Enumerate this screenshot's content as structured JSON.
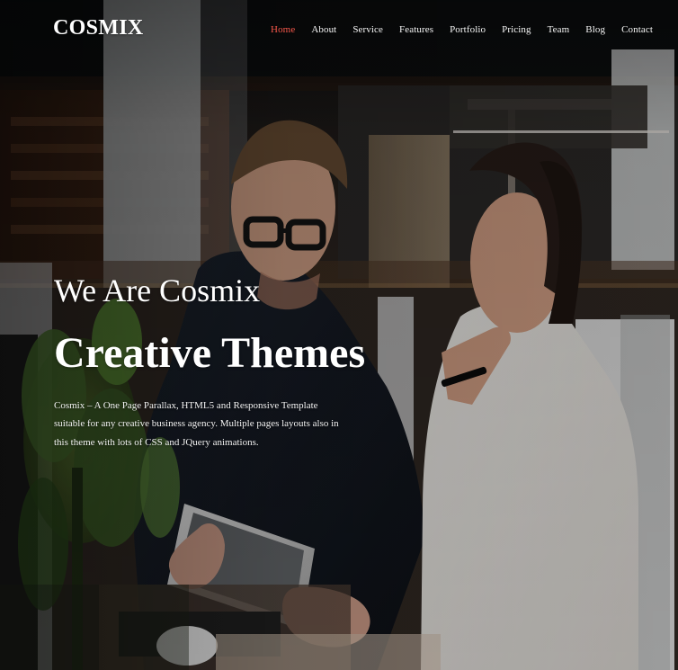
{
  "brand": {
    "name": "COSMIX"
  },
  "nav": {
    "items": [
      {
        "label": "Home"
      },
      {
        "label": "About"
      },
      {
        "label": "Service"
      },
      {
        "label": "Features"
      },
      {
        "label": "Portfolio"
      },
      {
        "label": "Pricing"
      },
      {
        "label": "Team"
      },
      {
        "label": "Blog"
      },
      {
        "label": "Contact"
      }
    ]
  },
  "hero": {
    "eyebrow": "We Are Cosmix",
    "headline": "Creative Themes",
    "description": "Cosmix – A One Page Parallax, HTML5 and Responsive Template suitable for any creative business agency. Multiple pages layouts also in this theme with lots of CSS and JQuery animations."
  },
  "colors": {
    "active_nav": "#ff5b4d",
    "text": "#ffffff"
  }
}
